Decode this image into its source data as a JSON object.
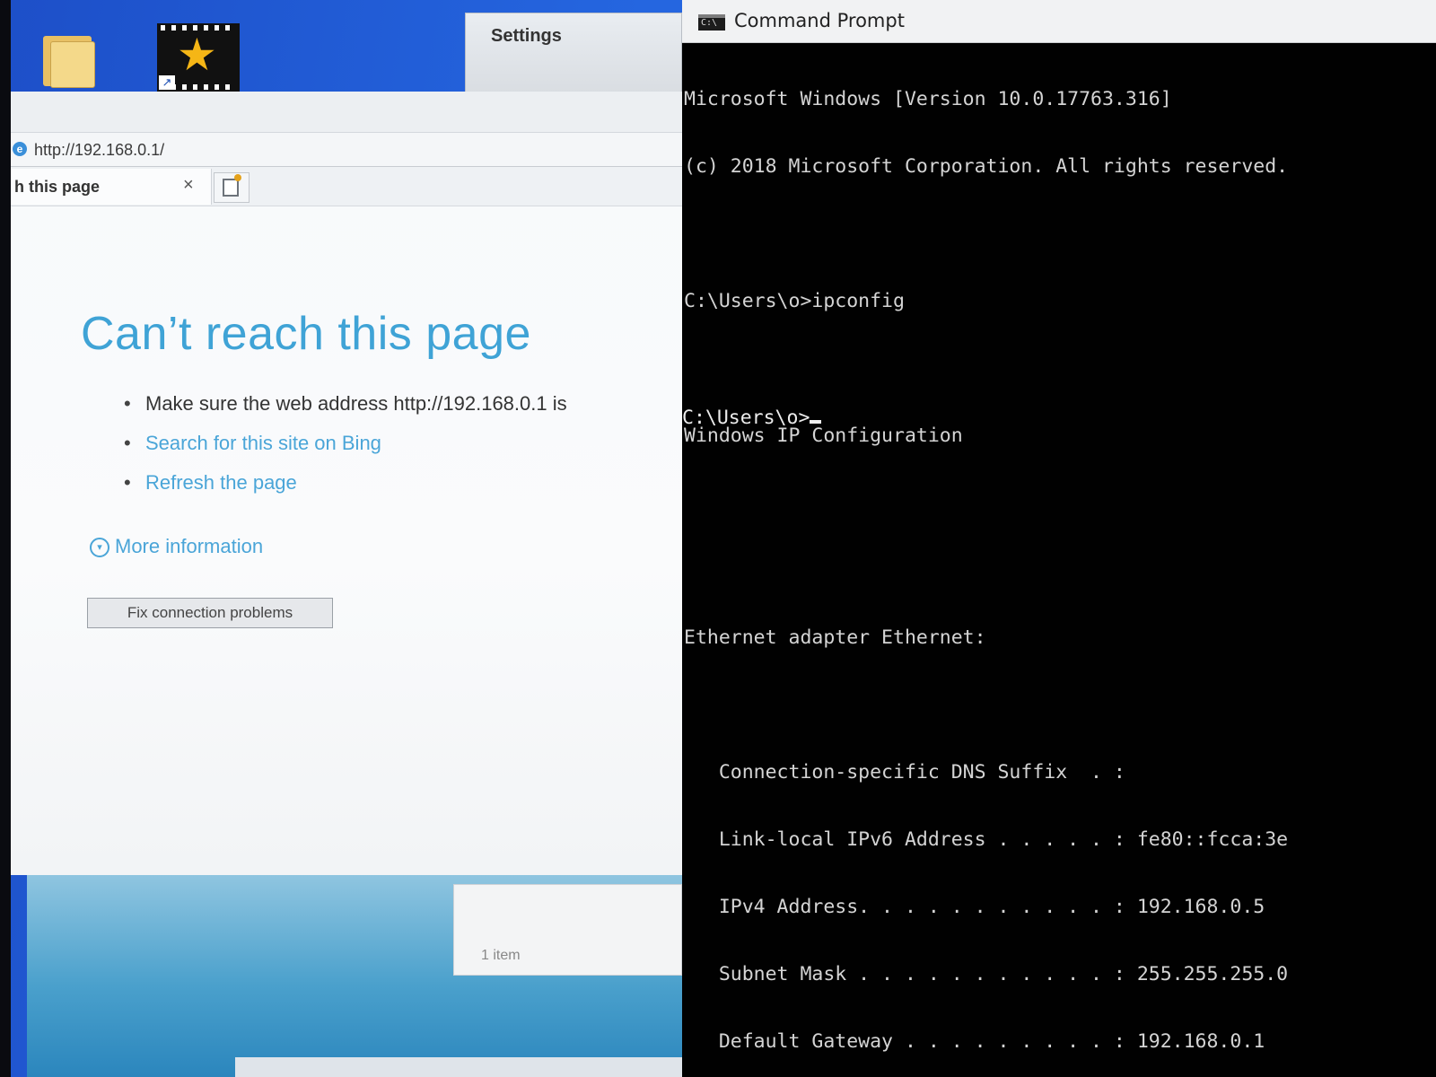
{
  "settings_window": {
    "title": "Settings"
  },
  "browser": {
    "url": "http://192.168.0.1/",
    "tab_title": "h this page",
    "tab_close": "×",
    "error_heading": "Can’t reach this page",
    "bullets": [
      {
        "text": "Make sure the web address http://192.168.0.1 is"
      },
      {
        "text": "Search for this site on Bing"
      },
      {
        "text": "Refresh the page"
      }
    ],
    "more_info": "More information",
    "fix_button": "Fix connection problems"
  },
  "explorer_fragment": {
    "item_count": "1 item"
  },
  "cmd": {
    "title": "Command Prompt",
    "lines": [
      "Microsoft Windows [Version 10.0.17763.316]",
      "(c) 2018 Microsoft Corporation. All rights reserved.",
      "",
      "C:\\Users\\o>ipconfig",
      "",
      "Windows IP Configuration",
      "",
      "",
      "Ethernet adapter Ethernet:",
      "",
      "   Connection-specific DNS Suffix  . :",
      "   Link-local IPv6 Address . . . . . : fe80::fcca:3e",
      "   IPv4 Address. . . . . . . . . . . : 192.168.0.5",
      "   Subnet Mask . . . . . . . . . . . : 255.255.255.0",
      "   Default Gateway . . . . . . . . . : 192.168.0.1"
    ],
    "prompt": "C:\\Users\\o>"
  },
  "icons": {
    "folder": "folder-icon",
    "movie": "movie-maker-icon",
    "browser": "edge-browser-icon",
    "cmd": "cmd-icon"
  },
  "colors": {
    "wallpaper": "#1e5fd4",
    "heading": "#3fa3d6",
    "link": "#4aa5d8",
    "console_bg": "#010101",
    "console_fg": "#d4d4d4"
  }
}
